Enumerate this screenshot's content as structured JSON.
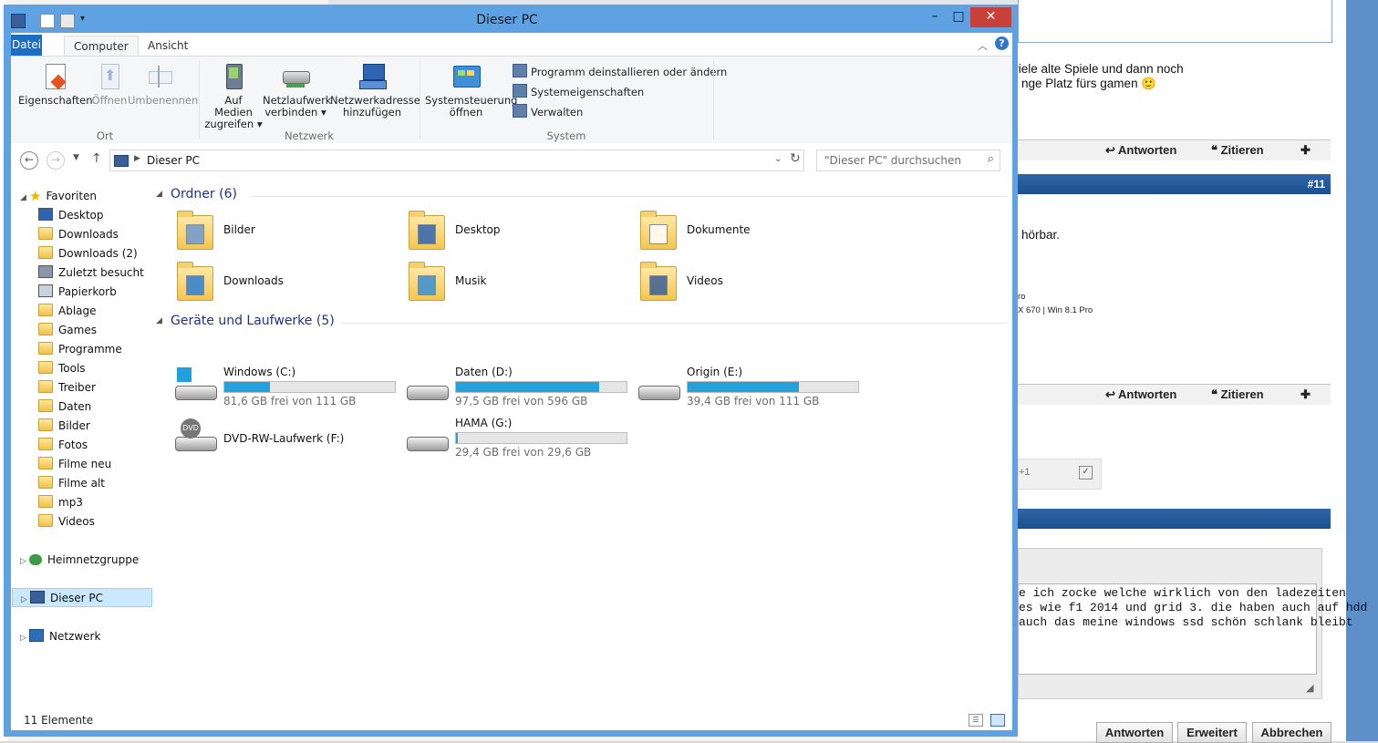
{
  "window": {
    "title": "Dieser PC",
    "minimize": "–",
    "maximize": "□",
    "close": "✕"
  },
  "ribbon": {
    "tabs": [
      "Datei",
      "Computer",
      "Ansicht"
    ],
    "groups": [
      {
        "label": "Ort",
        "buttons": [
          {
            "label": "Eigenschaften",
            "icon": "properties-icon",
            "enabled": true
          },
          {
            "label": "Öffnen",
            "icon": "open-icon",
            "enabled": false
          },
          {
            "label": "Umbenennen",
            "icon": "rename-icon",
            "enabled": false
          }
        ]
      },
      {
        "label": "Netzwerk",
        "buttons": [
          {
            "label1": "Auf Medien",
            "label2": "zugreifen ▾",
            "icon": "media-access-icon"
          },
          {
            "label1": "Netzlaufwerk",
            "label2": "verbinden ▾",
            "icon": "network-drive-icon"
          },
          {
            "label1": "Netzwerkadresse",
            "label2": "hinzufügen",
            "icon": "network-location-icon"
          }
        ]
      },
      {
        "label": "System",
        "buttons": [
          {
            "label1": "Systemsteuerung",
            "label2": "öffnen",
            "icon": "control-panel-icon"
          }
        ],
        "small": [
          "Programm deinstallieren oder ändern",
          "Systemeigenschaften",
          "Verwalten"
        ]
      }
    ]
  },
  "address": {
    "path": "Dieser PC",
    "search_placeholder": "\"Dieser PC\" durchsuchen"
  },
  "nav": {
    "favorites_label": "Favoriten",
    "favorites": [
      "Desktop",
      "Downloads",
      "Downloads (2)",
      "Zuletzt besucht",
      "Papierkorb",
      "Ablage",
      "Games",
      "Programme",
      "Tools",
      "Treiber",
      "Daten",
      "Bilder",
      "Fotos",
      "Filme neu",
      "Filme alt",
      "mp3",
      "Videos"
    ],
    "homegroup": "Heimnetzgruppe",
    "this_pc": "Dieser PC",
    "network": "Netzwerk"
  },
  "content": {
    "folders_header": "Ordner (6)",
    "folders": [
      "Bilder",
      "Desktop",
      "Dokumente",
      "Downloads",
      "Musik",
      "Videos"
    ],
    "drives_header": "Geräte und Laufwerke (5)",
    "drives": [
      {
        "name": "Windows (C:)",
        "free": "81,6 GB frei von 111 GB",
        "used_fraction": 0.27,
        "icon": "windows-drive-icon"
      },
      {
        "name": "Daten (D:)",
        "free": "97,5 GB frei von 596 GB",
        "used_fraction": 0.84,
        "icon": "hard-drive-icon"
      },
      {
        "name": "Origin (E:)",
        "free": "39,4 GB frei von 111 GB",
        "used_fraction": 0.65,
        "icon": "hard-drive-icon"
      },
      {
        "name": "DVD-RW-Laufwerk (F:)",
        "free": "",
        "icon": "dvd-drive-icon"
      },
      {
        "name": "HAMA (G:)",
        "free": "29,4 GB frei von 29,6 GB",
        "used_fraction": 0.01,
        "icon": "usb-drive-icon"
      }
    ]
  },
  "status": "11 Elemente",
  "background": {
    "post1_line1": "viele alte Spiele und dann noch",
    "post1_line2": "nge Platz fürs gamen 🙂",
    "answer": "Antworten",
    "quote": "Zitieren",
    "post_number": "#11",
    "post2_text": "hörbar.",
    "sig1": "ro",
    "sig2": "X 670 | Win 8.1 Pro",
    "plus": "+1",
    "textarea_lines": [
      "e ich zocke welche wirklich von den ladezeiten",
      "es wie f1 2014 und grid 3. die haben auch auf hdd",
      "auch das meine windows ssd schön schlank bleibt"
    ],
    "btn_answer": "Antworten",
    "btn_extended": "Erweitert",
    "btn_cancel": "Abbrechen"
  }
}
